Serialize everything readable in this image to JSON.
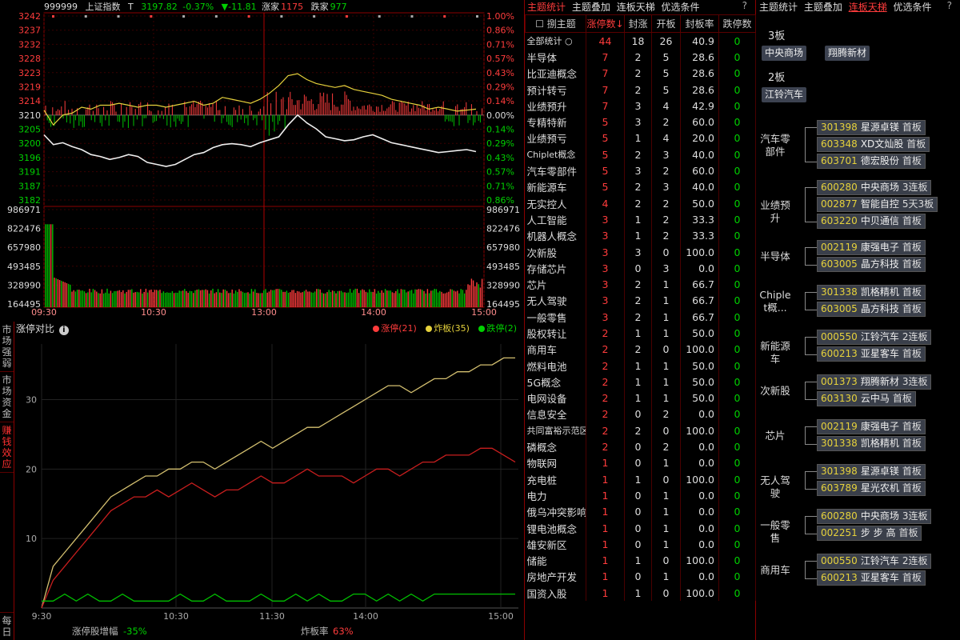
{
  "top": {
    "code": "999999",
    "name": "上证指数",
    "t": "T",
    "price": "3197.82",
    "pct": "-0.37%",
    "change": "▼-11.81",
    "up_label": "涨家",
    "up_count": "1175",
    "down_label": "跌家",
    "down_count": "977",
    "price_ticks": [
      "3242",
      "3237",
      "3232",
      "3228",
      "3223",
      "3219",
      "3214",
      "3210",
      "3205",
      "3200",
      "3196",
      "3191",
      "3187",
      "3182"
    ],
    "pct_ticks": [
      "1.00%",
      "0.86%",
      "0.71%",
      "0.57%",
      "0.43%",
      "0.29%",
      "0.14%",
      "0.00%",
      "0.14%",
      "0.29%",
      "0.43%",
      "0.57%",
      "0.71%",
      "0.86%"
    ],
    "vol_ticks": [
      "986971",
      "822476",
      "657980",
      "493485",
      "328990",
      "164495"
    ],
    "time_ticks": [
      "09:30",
      "10:30",
      "13:00",
      "14:00",
      "15:00"
    ]
  },
  "bottom": {
    "tabs": [
      "市场强弱",
      "市场资金",
      "赚钱效应",
      "每日"
    ],
    "title": "涨停对比",
    "legend": [
      {
        "label": "涨停(21)",
        "color": "#ff3c3c"
      },
      {
        "label": "炸板(35)",
        "color": "#e6d23c"
      },
      {
        "label": "跌停(2)",
        "color": "#00d000"
      }
    ],
    "y_ticks": [
      "30",
      "20",
      "10"
    ],
    "x_ticks": [
      "9:30",
      "10:30",
      "11:30",
      "14:00",
      "15:00"
    ],
    "footer": {
      "label1": "涨停股增幅",
      "value1": "-35%",
      "label2": "炸板率",
      "value2": "63%"
    }
  },
  "mid": {
    "tabs": [
      "主题统计",
      "主题叠加",
      "连板天梯",
      "优选条件"
    ],
    "help": "?",
    "headers": [
      "☐ 捌主题",
      "涨停数↓",
      "封涨",
      "开板",
      "封板率",
      "跌停数"
    ],
    "rows": [
      [
        "全部统计  ○",
        "44",
        "18",
        "26",
        "40.9",
        "0"
      ],
      [
        "半导体",
        "7",
        "2",
        "5",
        "28.6",
        "0"
      ],
      [
        "比亚迪概念",
        "7",
        "2",
        "5",
        "28.6",
        "0"
      ],
      [
        "预计转亏",
        "7",
        "2",
        "5",
        "28.6",
        "0"
      ],
      [
        "业绩预升",
        "7",
        "3",
        "4",
        "42.9",
        "0"
      ],
      [
        "专精特新",
        "5",
        "3",
        "2",
        "60.0",
        "0"
      ],
      [
        "业绩预亏",
        "5",
        "1",
        "4",
        "20.0",
        "0"
      ],
      [
        "Chiplet概念",
        "5",
        "2",
        "3",
        "40.0",
        "0"
      ],
      [
        "汽车零部件",
        "5",
        "3",
        "2",
        "60.0",
        "0"
      ],
      [
        "新能源车",
        "5",
        "2",
        "3",
        "40.0",
        "0"
      ],
      [
        "无实控人",
        "4",
        "2",
        "2",
        "50.0",
        "0"
      ],
      [
        "人工智能",
        "3",
        "1",
        "2",
        "33.3",
        "0"
      ],
      [
        "机器人概念",
        "3",
        "1",
        "2",
        "33.3",
        "0"
      ],
      [
        "次新股",
        "3",
        "3",
        "0",
        "100.0",
        "0"
      ],
      [
        "存储芯片",
        "3",
        "0",
        "3",
        "0.0",
        "0"
      ],
      [
        "芯片",
        "3",
        "2",
        "1",
        "66.7",
        "0"
      ],
      [
        "无人驾驶",
        "3",
        "2",
        "1",
        "66.7",
        "0"
      ],
      [
        "一般零售",
        "3",
        "2",
        "1",
        "66.7",
        "0"
      ],
      [
        "股权转让",
        "2",
        "1",
        "1",
        "50.0",
        "0"
      ],
      [
        "商用车",
        "2",
        "2",
        "0",
        "100.0",
        "0"
      ],
      [
        "燃料电池",
        "2",
        "1",
        "1",
        "50.0",
        "0"
      ],
      [
        "5G概念",
        "2",
        "1",
        "1",
        "50.0",
        "0"
      ],
      [
        "电网设备",
        "2",
        "1",
        "1",
        "50.0",
        "0"
      ],
      [
        "信息安全",
        "2",
        "0",
        "2",
        "0.0",
        "0"
      ],
      [
        "共同富裕示范区",
        "2",
        "2",
        "0",
        "100.0",
        "0"
      ],
      [
        "磷概念",
        "2",
        "0",
        "2",
        "0.0",
        "0"
      ],
      [
        "物联网",
        "1",
        "0",
        "1",
        "0.0",
        "0"
      ],
      [
        "充电桩",
        "1",
        "1",
        "0",
        "100.0",
        "0"
      ],
      [
        "电力",
        "1",
        "0",
        "1",
        "0.0",
        "0"
      ],
      [
        "俄乌冲突影响",
        "1",
        "0",
        "1",
        "0.0",
        "0"
      ],
      [
        "锂电池概念",
        "1",
        "0",
        "1",
        "0.0",
        "0"
      ],
      [
        "雄安新区",
        "1",
        "0",
        "1",
        "0.0",
        "0"
      ],
      [
        "储能",
        "1",
        "1",
        "0",
        "100.0",
        "0"
      ],
      [
        "房地产开发",
        "1",
        "0",
        "1",
        "0.0",
        "0"
      ],
      [
        "国资入股",
        "1",
        "1",
        "0",
        "100.0",
        "0"
      ]
    ]
  },
  "right": {
    "tabs": [
      "主题统计",
      "主题叠加",
      "连板天梯",
      "优选条件"
    ],
    "help": "?",
    "boards": [
      {
        "label": "3板",
        "chips": [
          "中央商场",
          "翔腾新材"
        ]
      },
      {
        "label": "2板",
        "chips": [
          "江铃汽车"
        ]
      }
    ],
    "themes": [
      {
        "name": "汽车零部件",
        "stocks": [
          [
            "301398",
            "星源卓镁",
            "首板"
          ],
          [
            "603348",
            "XD文灿股",
            "首板"
          ],
          [
            "603701",
            "德宏股份",
            "首板"
          ]
        ]
      },
      {
        "name": "业绩预升",
        "stocks": [
          [
            "600280",
            "中央商场",
            "3连板"
          ],
          [
            "002877",
            "智能自控",
            "5天3板"
          ],
          [
            "603220",
            "中贝通信",
            "首板"
          ]
        ]
      },
      {
        "name": "半导体",
        "stocks": [
          [
            "002119",
            "康强电子",
            "首板"
          ],
          [
            "603005",
            "晶方科技",
            "首板"
          ]
        ]
      },
      {
        "name": "Chiplet概...",
        "stocks": [
          [
            "301338",
            "凯格精机",
            "首板"
          ],
          [
            "603005",
            "晶方科技",
            "首板"
          ]
        ]
      },
      {
        "name": "新能源车",
        "stocks": [
          [
            "000550",
            "江铃汽车",
            "2连板"
          ],
          [
            "600213",
            "亚星客车",
            "首板"
          ]
        ]
      },
      {
        "name": "次新股",
        "stocks": [
          [
            "001373",
            "翔腾新材",
            "3连板"
          ],
          [
            "603130",
            "云中马",
            "首板"
          ]
        ]
      },
      {
        "name": "芯片",
        "stocks": [
          [
            "002119",
            "康强电子",
            "首板"
          ],
          [
            "301338",
            "凯格精机",
            "首板"
          ]
        ]
      },
      {
        "name": "无人驾驶",
        "stocks": [
          [
            "301398",
            "星源卓镁",
            "首板"
          ],
          [
            "603789",
            "星光农机",
            "首板"
          ]
        ]
      },
      {
        "name": "一般零售",
        "stocks": [
          [
            "600280",
            "中央商场",
            "3连板"
          ],
          [
            "002251",
            "步 步 高",
            "首板"
          ]
        ]
      },
      {
        "name": "商用车",
        "stocks": [
          [
            "000550",
            "江铃汽车",
            "2连板"
          ],
          [
            "600213",
            "亚星客车",
            "首板"
          ]
        ]
      }
    ]
  },
  "colors": {
    "up": "#ff3c3c",
    "down": "#00d000",
    "border": "#8b0000",
    "yellow": "#e6d23c"
  }
}
